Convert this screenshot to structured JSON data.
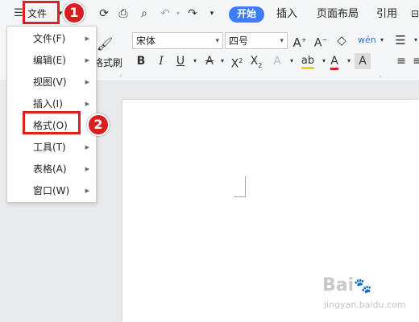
{
  "toolbar": {
    "file_label": "文件",
    "tabs": [
      "开始",
      "插入",
      "页面布局",
      "引用"
    ]
  },
  "ribbon": {
    "format_painter_label": "格式刷",
    "font_name": "宋体",
    "font_size": "四号"
  },
  "menu": {
    "items": [
      {
        "label": "文件(F)"
      },
      {
        "label": "编辑(E)"
      },
      {
        "label": "视图(V)"
      },
      {
        "label": "插入(I)"
      },
      {
        "label": "格式(O)"
      },
      {
        "label": "工具(T)"
      },
      {
        "label": "表格(A)"
      },
      {
        "label": "窗口(W)"
      }
    ]
  },
  "annotations": {
    "step1": "1",
    "step2": "2"
  },
  "watermark": {
    "brand": "Bai",
    "site": "jingyan.baidu.com"
  },
  "colors": {
    "accent": "#3d7dfc",
    "annotation_red": "#d81e1e",
    "ribbon_bg": "#f5f6f7",
    "canvas_bg": "#e9eaec"
  }
}
